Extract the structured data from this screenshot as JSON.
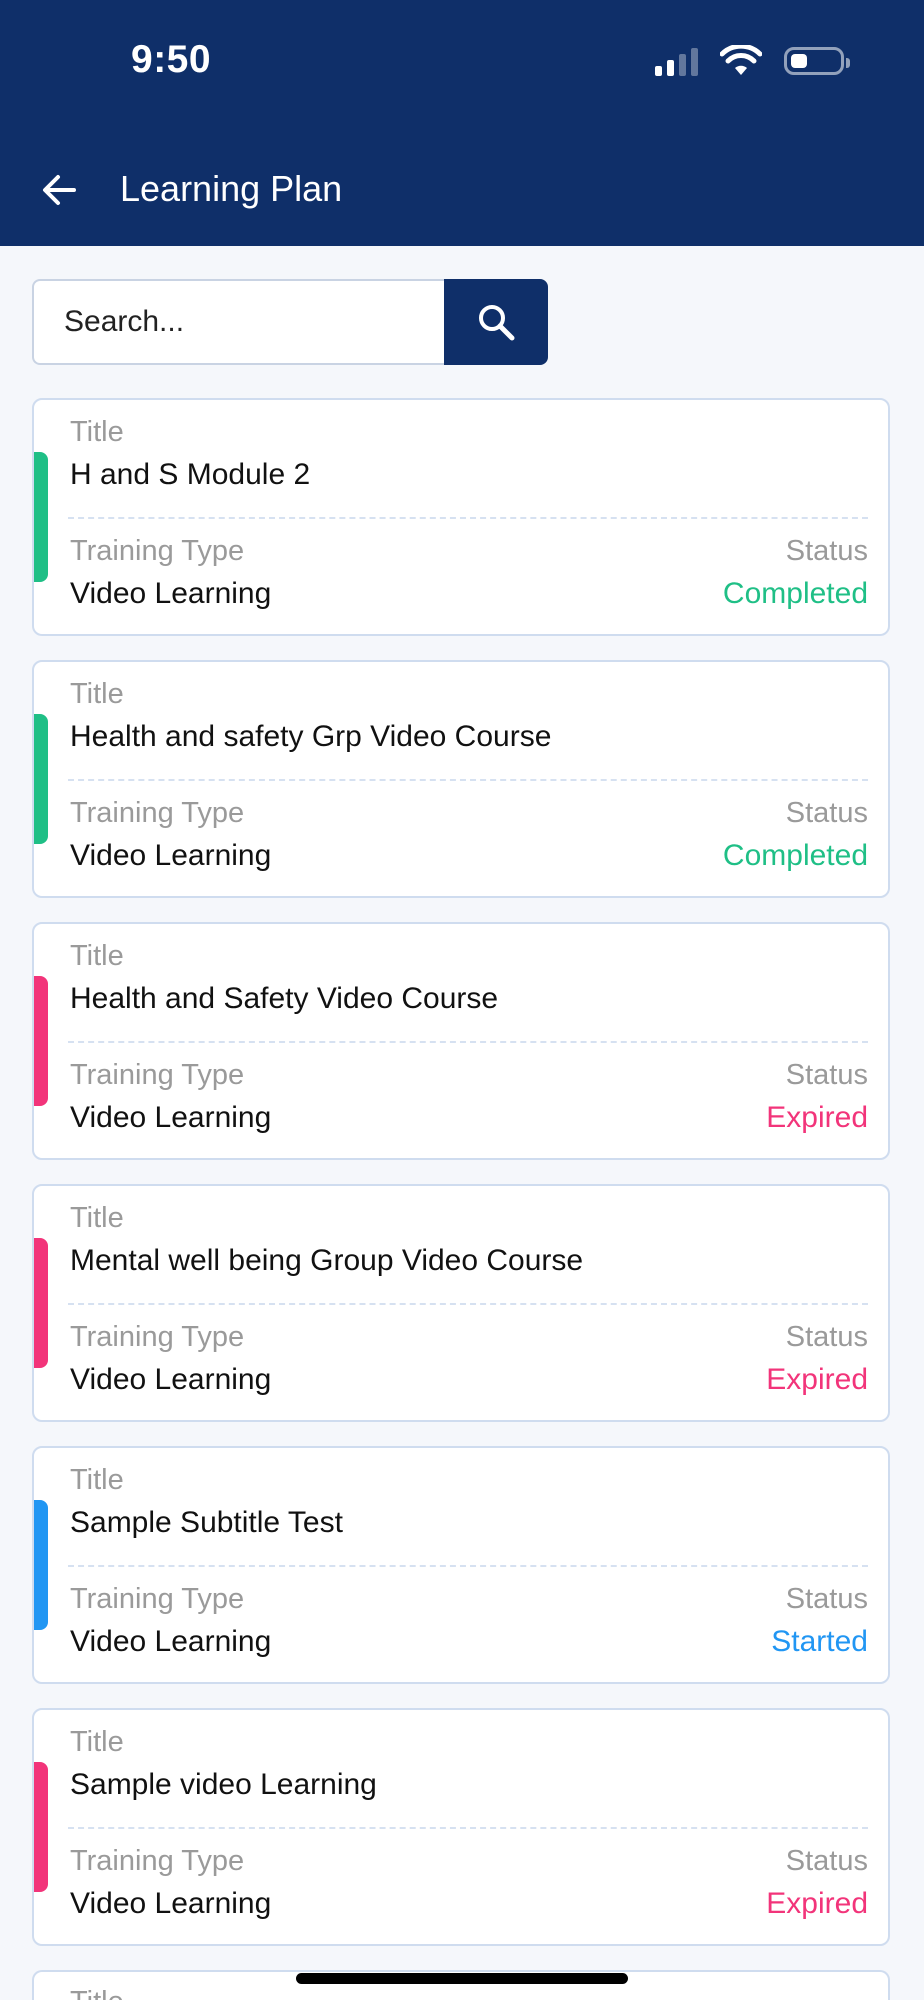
{
  "status_bar": {
    "time": "9:50"
  },
  "header": {
    "title": "Learning Plan"
  },
  "search": {
    "placeholder": "Search..."
  },
  "labels": {
    "title": "Title",
    "training_type": "Training Type",
    "status": "Status"
  },
  "status_colors": {
    "Completed": "#1fbf86",
    "Expired": "#f2347a",
    "Started": "#2196f3"
  },
  "cards": [
    {
      "title": "H and S Module 2",
      "training_type": "Video Learning",
      "status": "Completed"
    },
    {
      "title": "Health and safety Grp Video Course",
      "training_type": "Video Learning",
      "status": "Completed"
    },
    {
      "title": "Health and Safety Video Course",
      "training_type": "Video Learning",
      "status": "Expired"
    },
    {
      "title": "Mental well being Group Video Course",
      "training_type": "Video Learning",
      "status": "Expired"
    },
    {
      "title": "Sample Subtitle Test",
      "training_type": "Video Learning",
      "status": "Started"
    },
    {
      "title": "Sample video Learning",
      "training_type": "Video Learning",
      "status": "Expired"
    }
  ],
  "partial_card": {
    "title_label": "Title"
  }
}
